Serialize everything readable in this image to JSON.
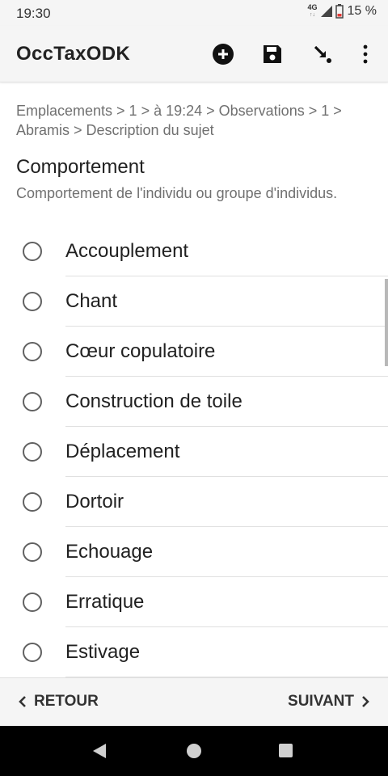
{
  "status_bar": {
    "time": "19:30",
    "network_type": "4G",
    "network_sub": "↑↓",
    "battery_percent": "15 %",
    "signal_icon": "signal-icon",
    "battery_icon": "battery-low-icon"
  },
  "app_bar": {
    "title": "OccTaxODK",
    "actions": [
      "add-circle-icon",
      "save-icon",
      "jump-arrow-icon",
      "more-vert-icon"
    ]
  },
  "form": {
    "breadcrumb": "Emplacements > 1 > à 19:24 > Observations > 1 > Abramis > Description du sujet",
    "question_label": "Comportement",
    "question_hint": "Comportement de l'individu ou groupe d'individus.",
    "options": [
      "Accouplement",
      "Chant",
      "Cœur copulatoire",
      "Construction de toile",
      "Déplacement",
      "Dortoir",
      "Echouage",
      "Erratique",
      "Estivage"
    ]
  },
  "navigation": {
    "back_label": "RETOUR",
    "next_label": "SUIVANT"
  },
  "colors": {
    "app_bar_bg": "#f5f5f5",
    "secondary_text": "#707070",
    "primary_text": "#212121",
    "system_nav_bg": "#000000"
  }
}
